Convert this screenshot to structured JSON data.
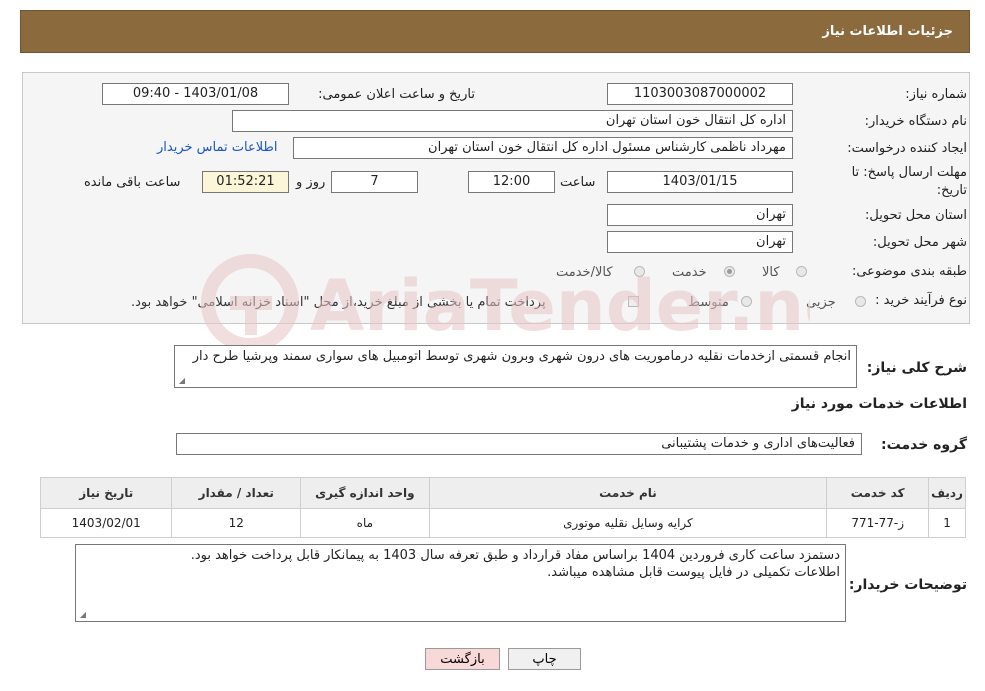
{
  "header": {
    "title": "جزئیات اطلاعات نیاز"
  },
  "form": {
    "need_number_label": "شماره نیاز:",
    "need_number": "1103003087000002",
    "announce_label": "تاریخ و ساعت اعلان عمومی:",
    "announce_value": "1403/01/08 - 09:40",
    "buyer_org_label": "نام دستگاه خریدار:",
    "buyer_org": "اداره کل انتقال خون استان تهران",
    "creator_label": "ایجاد کننده درخواست:",
    "creator": "مهرداد ناظمی کارشناس مسئول اداره کل انتقال خون استان تهران",
    "contact_link": "اطلاعات تماس خریدار",
    "deadline_label": "مهلت ارسال پاسخ: تا",
    "deadline_label2": "تاریخ:",
    "deadline_date": "1403/01/15",
    "time_label": "ساعت",
    "deadline_time": "12:00",
    "days_value": "7",
    "days_label": "روز و",
    "remaining_time": "01:52:21",
    "remaining_label": "ساعت باقی مانده",
    "province_label": "استان محل تحویل:",
    "province": "تهران",
    "city_label": "شهر محل تحویل:",
    "city": "تهران",
    "category_label": "طبقه بندی موضوعی:",
    "category_options": [
      "کالا",
      "خدمت",
      "کالا/خدمت"
    ],
    "category_selected": "خدمت",
    "process_label": "نوع فرآیند خرید :",
    "process_options": [
      "جزیی",
      "متوسط"
    ],
    "payment_note": "پرداخت تمام یا بخشی از مبلغ خرید،از محل \"اسناد خزانه اسلامی\" خواهد بود."
  },
  "summary": {
    "label": "شرح کلی نیاز:",
    "text": "انجام قسمتی ازخدمات نقلیه درماموریت های درون شهری وبرون شهری توسط اتومبیل های سواری سمند وپرشیا طرح دار"
  },
  "services": {
    "section_title": "اطلاعات خدمات مورد نیاز",
    "group_label": "گروه خدمت:",
    "group_value": "فعالیت‌های اداری و خدمات پشتیبانی"
  },
  "table": {
    "headers": [
      "ردیف",
      "کد خدمت",
      "نام خدمت",
      "واحد اندازه گیری",
      "تعداد / مقدار",
      "تاریخ نیاز"
    ],
    "rows": [
      [
        "1",
        "ز-77-771",
        "کرایه وسایل نقلیه موتوری",
        "ماه",
        "12",
        "1403/02/01"
      ]
    ]
  },
  "buyer_notes": {
    "label": "توضیحات خریدار:",
    "line1": "دستمزد ساعت کاری فروردین 1404 براساس مفاد قرارداد و طبق تعرفه سال 1403 به پیمانکار قابل پرداخت خواهد بود.",
    "line2": "اطلاعات تکمیلی در فایل پیوست قابل مشاهده میباشد."
  },
  "buttons": {
    "print": "چاپ",
    "back": "بازگشت"
  },
  "watermark": {
    "text": "AriaTender.neT"
  },
  "colors": {
    "header_bg": "#8b6a3e",
    "link": "#1a55c0",
    "back_button_bg": "#f9d8d8",
    "watermark": "#e8c4c4"
  },
  "icons": {
    "resize": "resize-grip-icon",
    "logo": "watermark-logo-icon"
  }
}
